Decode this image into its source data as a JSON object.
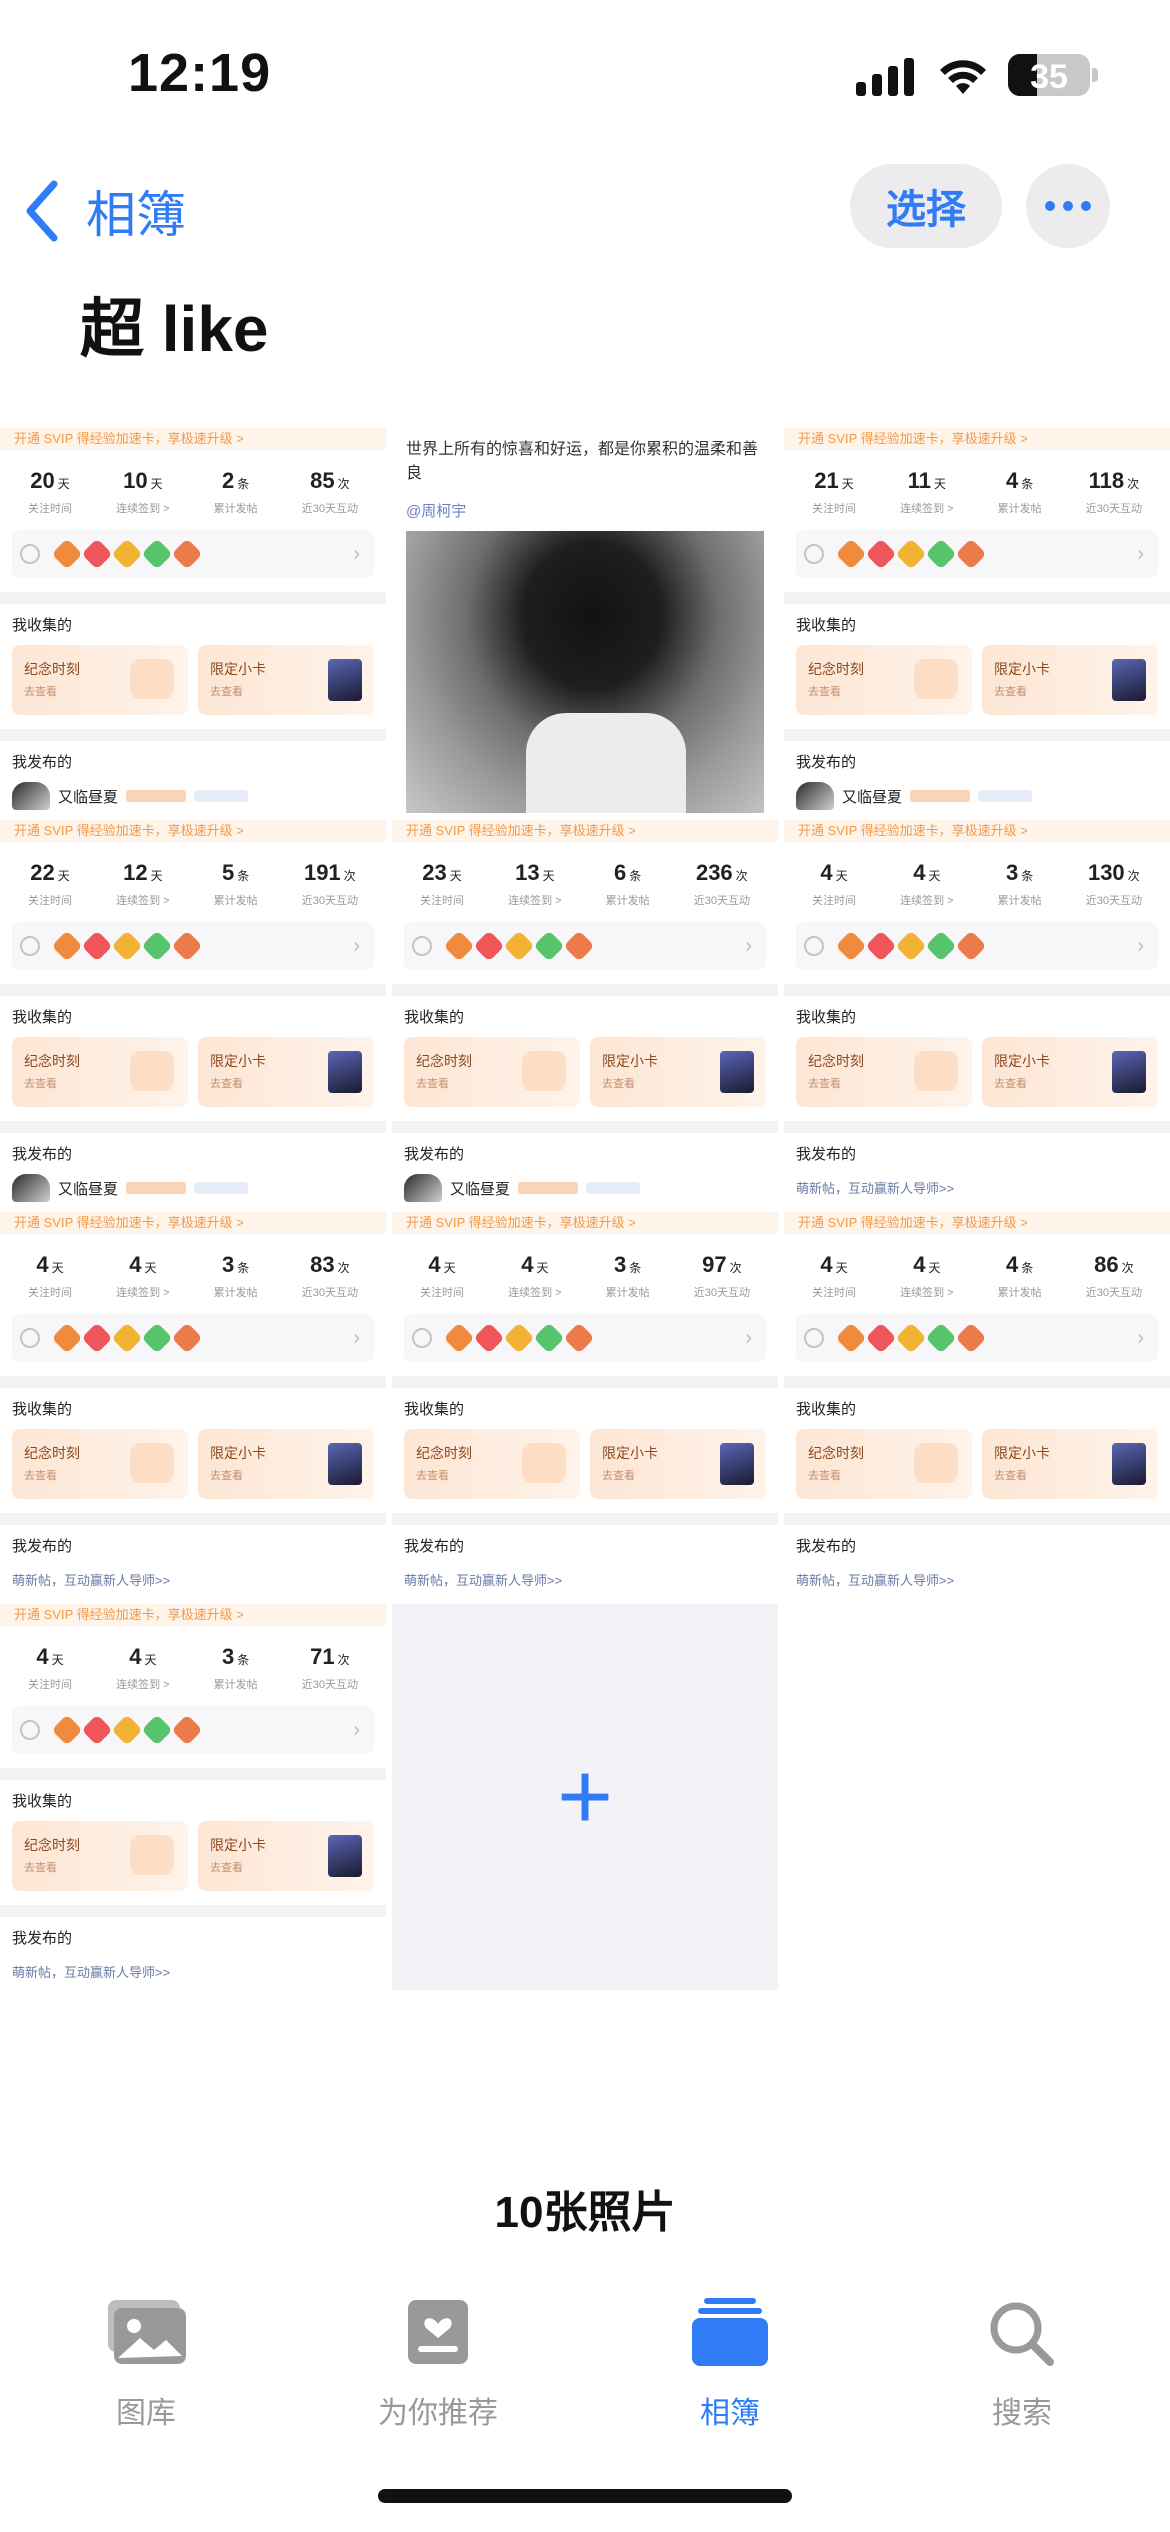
{
  "status_bar": {
    "time": "12:19",
    "battery": "35",
    "battery_fraction": 0.35
  },
  "nav": {
    "back_label": "相簿",
    "select_label": "选择"
  },
  "album": {
    "title": "超 like",
    "photo_count": "10张照片"
  },
  "shared": {
    "promo": "开通 SVIP 得经验加速卡，享极速升级 >",
    "stat_labels": [
      "关注时间",
      "连续签到 >",
      "累计发帖",
      "近30天互动"
    ],
    "collected_label": "我收集的",
    "card_memorial": "纪念时刻",
    "card_limited": "限定小卡",
    "card_sub": "去查看",
    "published_label": "我发布的",
    "username": "又临昼夏",
    "new_post": "萌新帖，互动赢新人导师>>"
  },
  "caption_post": {
    "text": "世界上所有的惊喜和好运，都是你累积的温柔和善良",
    "mention": "@周柯宇"
  },
  "tiles": [
    {
      "stats": [
        {
          "value": "20",
          "unit": "天"
        },
        {
          "value": "10",
          "unit": "天"
        },
        {
          "value": "2",
          "unit": "条"
        },
        {
          "value": "85",
          "unit": "次"
        }
      ]
    },
    {
      "stats": [
        {
          "value": "21",
          "unit": "天"
        },
        {
          "value": "11",
          "unit": "天"
        },
        {
          "value": "4",
          "unit": "条"
        },
        {
          "value": "118",
          "unit": "次"
        }
      ]
    },
    {
      "stats": [
        {
          "value": "22",
          "unit": "天"
        },
        {
          "value": "12",
          "unit": "天"
        },
        {
          "value": "5",
          "unit": "条"
        },
        {
          "value": "191",
          "unit": "次"
        }
      ]
    },
    {
      "stats": [
        {
          "value": "23",
          "unit": "天"
        },
        {
          "value": "13",
          "unit": "天"
        },
        {
          "value": "6",
          "unit": "条"
        },
        {
          "value": "236",
          "unit": "次"
        }
      ]
    },
    {
      "stats": [
        {
          "value": "4",
          "unit": "天"
        },
        {
          "value": "4",
          "unit": "天"
        },
        {
          "value": "3",
          "unit": "条"
        },
        {
          "value": "130",
          "unit": "次"
        }
      ]
    },
    {
      "stats": [
        {
          "value": "4",
          "unit": "天"
        },
        {
          "value": "4",
          "unit": "天"
        },
        {
          "value": "3",
          "unit": "条"
        },
        {
          "value": "83",
          "unit": "次"
        }
      ]
    },
    {
      "stats": [
        {
          "value": "4",
          "unit": "天"
        },
        {
          "value": "4",
          "unit": "天"
        },
        {
          "value": "3",
          "unit": "条"
        },
        {
          "value": "97",
          "unit": "次"
        }
      ]
    },
    {
      "stats": [
        {
          "value": "4",
          "unit": "天"
        },
        {
          "value": "4",
          "unit": "天"
        },
        {
          "value": "4",
          "unit": "条"
        },
        {
          "value": "86",
          "unit": "次"
        }
      ]
    },
    {
      "stats": [
        {
          "value": "4",
          "unit": "天"
        },
        {
          "value": "4",
          "unit": "天"
        },
        {
          "value": "3",
          "unit": "条"
        },
        {
          "value": "71",
          "unit": "次"
        }
      ]
    }
  ],
  "badge_colors": [
    "#f08a3c",
    "#f0555a",
    "#f2b233",
    "#57c46b",
    "#ec7a4a"
  ],
  "tabbar": {
    "items": [
      {
        "label": "图库",
        "icon": "photo-library-icon"
      },
      {
        "label": "为你推荐",
        "icon": "for-you-icon"
      },
      {
        "label": "相簿",
        "icon": "albums-icon"
      },
      {
        "label": "搜索",
        "icon": "search-icon"
      }
    ],
    "active_index": 2,
    "accent": "#2f7cf6"
  }
}
